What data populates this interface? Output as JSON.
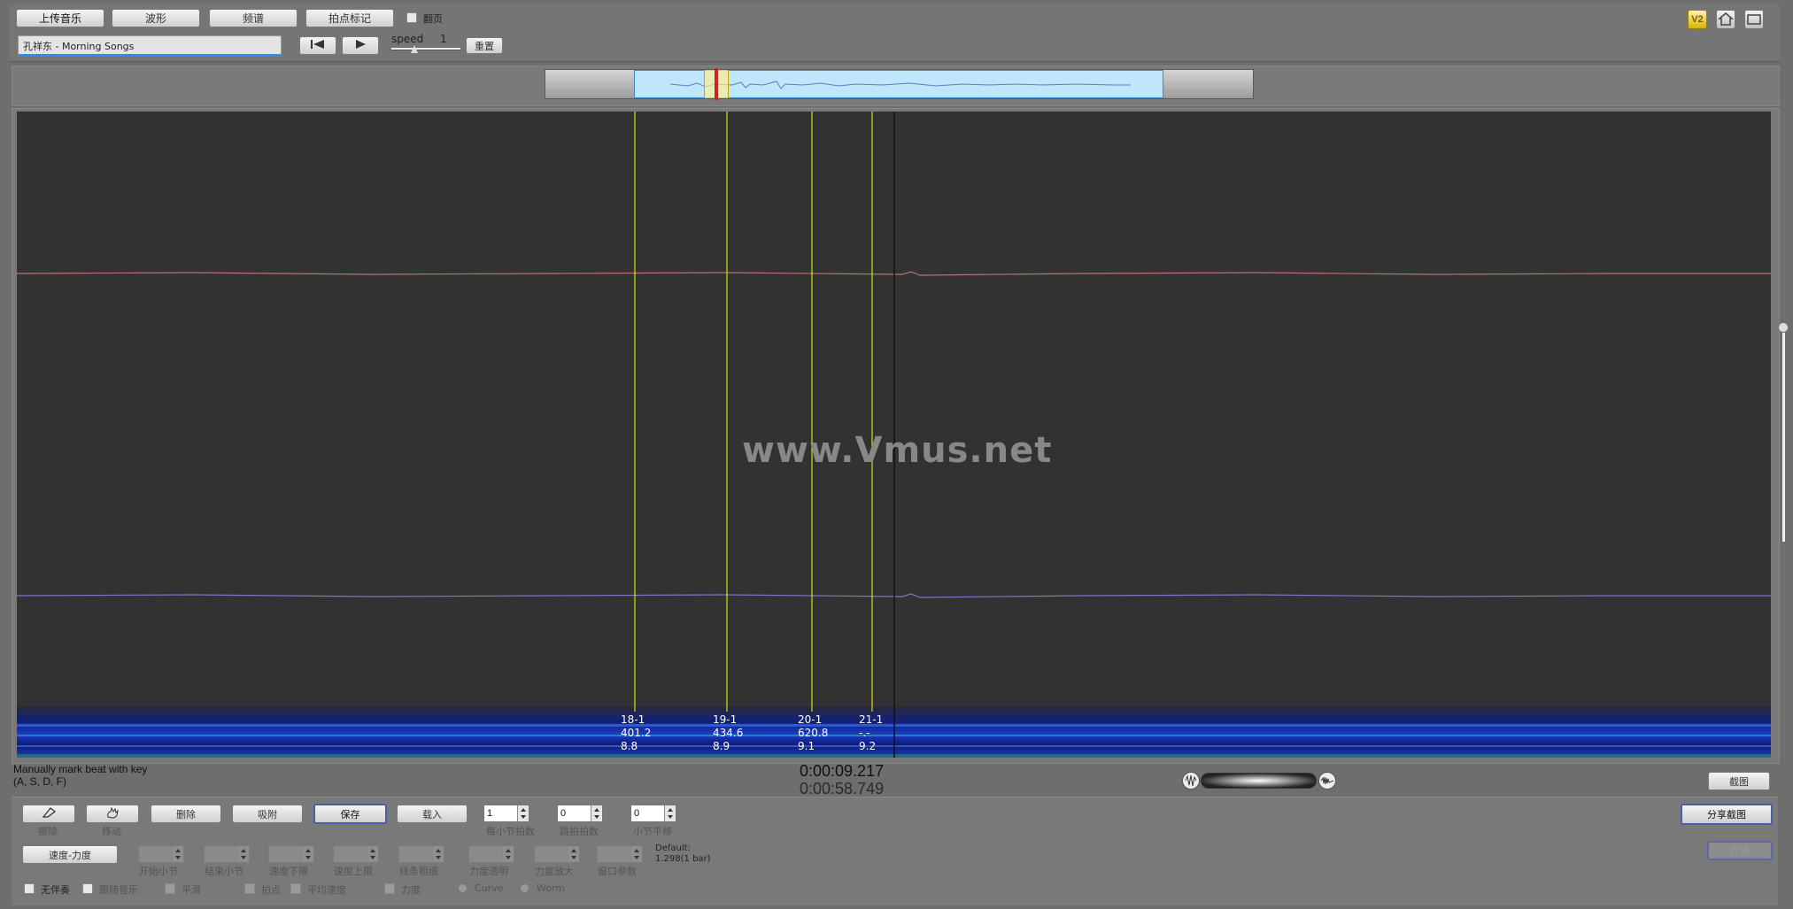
{
  "toolbar": {
    "upload_label": "上传音乐",
    "waveform_label": "波形",
    "spectrum_label": "频谱",
    "beat_mark_label": "拍点标记",
    "page_turn_label": "翻页",
    "track_name": "孔祥东 - Morning Songs",
    "speed_label": "speed",
    "speed_value": "1",
    "reset_label": "重置"
  },
  "top_icons": {
    "v2_label": "V2"
  },
  "viewer": {
    "watermark": "www.Vmus.net",
    "beats": [
      {
        "bar": "18-1",
        "tempo": "401.2",
        "time": "8.8"
      },
      {
        "bar": "19-1",
        "tempo": "434.6",
        "time": "8.9"
      },
      {
        "bar": "20-1",
        "tempo": "620.8",
        "time": "9.1"
      },
      {
        "bar": "21-1",
        "tempo": "-.-",
        "time": "9.2"
      }
    ]
  },
  "status": {
    "hint_line1": "Manually mark beat with key",
    "hint_line2": "(A, S, D, F)",
    "current_time": "0:00:09.217",
    "total_time": "0:00:58.749",
    "screenshot_label": "截图"
  },
  "bottom": {
    "erase_label": "擦除",
    "move_label": "移动",
    "delete_label": "删除",
    "snap_label": "吸附",
    "save_label": "保存",
    "load_label": "载入",
    "beats_per_bar_value": "1",
    "beats_per_bar_label": "每小节拍数",
    "skip_beats_value": "0",
    "skip_beats_label": "跳拍拍数",
    "bar_offset_value": "0",
    "bar_offset_label": "小节平移",
    "share_label": "分享截图",
    "grey_btn_label": "完成",
    "tempo_dyn_label": "速度-力度",
    "start_bar_label": "开始小节",
    "end_bar_label": "结束小节",
    "tempo_lower_label": "速度下限",
    "tempo_upper_label": "速度上限",
    "line_width_label": "线条粗细",
    "dyn_transparency_label": "力度透明",
    "dyn_zoom_label": "力度放大",
    "window_param_label": "窗口参数",
    "default_label": "Default:",
    "default_value": "1.298(1 bar)",
    "no_accompaniment_label": "无伴奏",
    "follow_music_label": "跟随音乐",
    "smooth_label": "平滑",
    "beat_label": "拍点",
    "avg_tempo_label": "平均速度",
    "dynamics_label": "力度",
    "curve_label": "Curve",
    "worm_label": "Worm"
  },
  "colors": {
    "background": "#6e6e6e",
    "viewer_bg": "#323232",
    "beat_line": "#ffff00",
    "upper_wave": "#b87474",
    "lower_wave": "#7a78c8",
    "overview_selection": "#bfe6fb",
    "playhead": "#d21f1f"
  }
}
